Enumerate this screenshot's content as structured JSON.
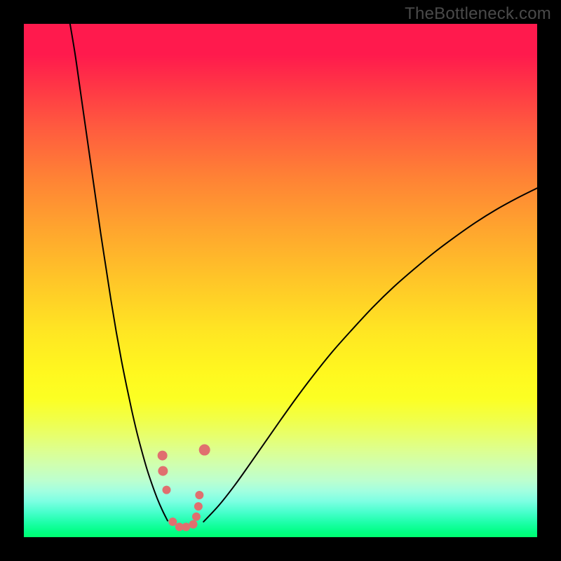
{
  "watermark": "TheBottleneck.com",
  "chart_data": {
    "type": "line",
    "title": "",
    "xlabel": "",
    "ylabel": "",
    "xlim": [
      0,
      100
    ],
    "ylim": [
      0,
      100
    ],
    "grid": false,
    "legend": false,
    "background_gradient": {
      "top_color": "#ff1a4d",
      "bottom_color": "#00ff70",
      "description": "vertical red-to-green gradient"
    },
    "series": [
      {
        "name": "curve-left",
        "color": "#000000",
        "x": [
          9,
          10,
          11,
          12,
          13,
          14,
          15,
          16,
          17,
          18,
          19,
          20,
          21,
          22,
          23,
          24,
          25,
          26,
          27,
          28
        ],
        "values": [
          100,
          94,
          87,
          80,
          73,
          66,
          59,
          52.5,
          46,
          40,
          34.5,
          29.5,
          24.8,
          20.5,
          16.7,
          13.2,
          10.2,
          7.5,
          5.2,
          3.2
        ]
      },
      {
        "name": "curve-right",
        "color": "#000000",
        "x": [
          35,
          38,
          41,
          44,
          47,
          50,
          53,
          56,
          60,
          64,
          68,
          72,
          76,
          80,
          84,
          88,
          92,
          96,
          100
        ],
        "values": [
          3.0,
          6.2,
          10.0,
          14.2,
          18.5,
          22.8,
          27.0,
          31.0,
          36.0,
          40.5,
          44.8,
          48.7,
          52.2,
          55.5,
          58.5,
          61.3,
          63.8,
          66.0,
          68.0
        ]
      }
    ],
    "markers": {
      "name": "highlight-points",
      "color": "#e06f6f",
      "x": [
        27.0,
        27.1,
        27.8,
        29.0,
        30.3,
        31.6,
        33.0,
        33.6,
        34.0,
        34.2,
        35.2
      ],
      "values": [
        15.9,
        12.9,
        9.2,
        3.0,
        2.0,
        2.0,
        2.5,
        4.0,
        6.0,
        8.2,
        17.0
      ],
      "size": [
        14,
        14,
        12,
        12,
        12,
        12,
        12,
        12,
        12,
        12,
        16
      ]
    }
  }
}
